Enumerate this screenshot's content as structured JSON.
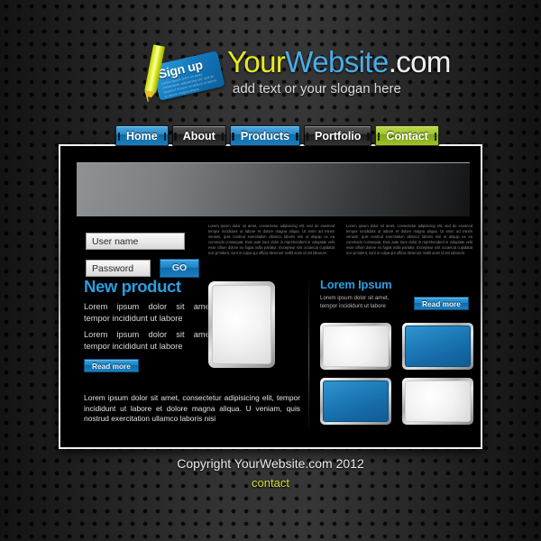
{
  "header": {
    "logo": {
      "badge_text": "Sign up",
      "badge_subtext": "Lorem ipsum dolor sit amet, consectetur adipisicing elit, sed do eiusmod tempor incididunt ut labore et dolore magna aliqua."
    },
    "brand": {
      "part1": "Your",
      "part2": "Website",
      "part3": ".com",
      "color1": "#e7eb22",
      "color2": "#49aee8",
      "color3": "#f2f2f2"
    },
    "slogan": "add text or your slogan here"
  },
  "nav": {
    "items": [
      {
        "label": "Home",
        "style": "blue"
      },
      {
        "label": "About",
        "style": "dark"
      },
      {
        "label": "Products",
        "style": "blue"
      },
      {
        "label": "Portfolio",
        "style": "dark"
      },
      {
        "label": "Contact",
        "style": "green"
      }
    ]
  },
  "login": {
    "username_value": "User name",
    "username_placeholder": "User name",
    "password_value": "Password",
    "password_placeholder": "Password",
    "go_label": "GO"
  },
  "intro": {
    "column_left": "Lorem ipsum dolor sit amet, consectetur adipisicing elit, sed do eiusmod tempor incididunt ut labore et dolore magna aliqua. Ut enim ad minim veniam, quis nostrud exercitation ullamco laboris nisi ut aliquip ex ea commodo consequat. Duis aute irure dolor in reprehenderit in voluptate velit esse cillum dolore eu fugiat nulla pariatur. Excepteur sint occaecat cupidatat non proident, sunt in culpa qui officia deserunt mollit anim id est laborum.",
    "column_right": "Lorem ipsum dolor sit amet, consectetur adipisicing elit, sed do eiusmod tempor incididunt ut labore et dolore magna aliqua. Ut enim ad minim veniam, quis nostrud exercitation ullamco laboris nisi ut aliquip ex ea commodo consequat. Duis aute irure dolor in reprehenderit in voluptate velit esse cillum dolore eu fugiat nulla pariatur. Excepteur sint occaecat cupidatat non proident, sunt in culpa qui officia deserunt mollit anim id est laborum."
  },
  "new_product": {
    "title": "New product",
    "title_color": "#2a9fe0",
    "paragraph_1": "Lorem ipsum dolor sit amet, tempor incididunt ut labore",
    "paragraph_2": "Lorem ipsum dolor sit amet, tempor incididunt ut labore",
    "read_more_label": "Read more"
  },
  "right_panel": {
    "title": "Lorem Ipsum",
    "title_color": "#2a9fe0",
    "text": "Lorem ipsum dolor sit amet, tempor incididunt ut labore",
    "read_more_label": "Read more",
    "thumbnails": [
      {
        "face": "white"
      },
      {
        "face": "blue"
      },
      {
        "face": "blue"
      },
      {
        "face": "white"
      }
    ]
  },
  "bottom_text": "Lorem ipsum dolor sit amet, consectetur adipisicing elit, tempor incididunt ut labore et dolore magna aliqua. U veniam, quis nostrud exercitation ullamco laboris nisi",
  "footer": {
    "copyright": "Copyright YourWebsite.com 2012",
    "contact_label": "contact",
    "contact_color": "#d7dd2c"
  }
}
